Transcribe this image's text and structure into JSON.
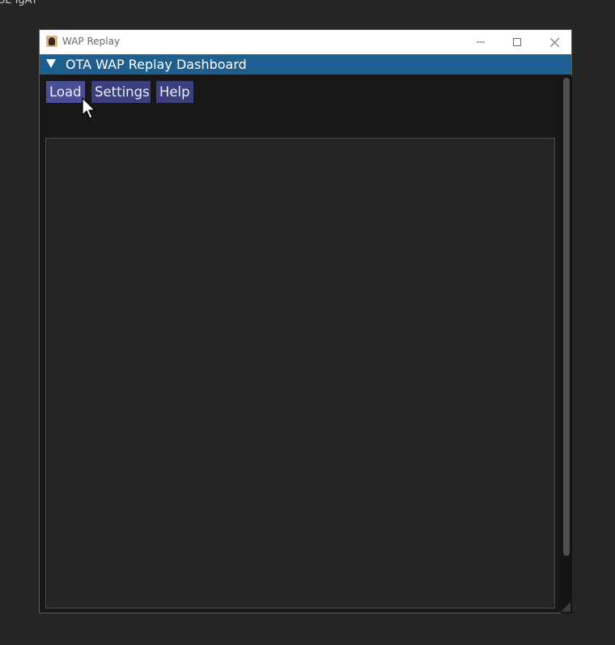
{
  "desktop": {
    "background_text": "SE IgAT"
  },
  "window": {
    "title": "WAP Replay",
    "icon": "app-icon",
    "controls": {
      "minimize": "minimize-icon",
      "maximize": "maximize-icon",
      "close": "close-icon"
    }
  },
  "header": {
    "title": "OTA WAP Replay Dashboard",
    "collapse_icon": "triangle-down-icon",
    "color": "#1f5f8f"
  },
  "menu": {
    "buttons": [
      {
        "label": "Load"
      },
      {
        "label": "Settings"
      },
      {
        "label": "Help"
      }
    ],
    "button_color": "#3b3f7d"
  },
  "colors": {
    "window_bg": "#181818",
    "panel_bg": "#252525",
    "desktop_bg": "#252526"
  }
}
